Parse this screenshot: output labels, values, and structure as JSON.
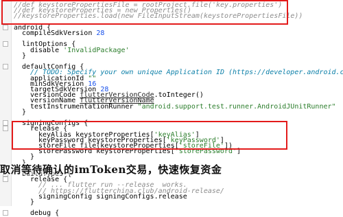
{
  "editor": {
    "lines": [
      {
        "indent": 0,
        "parts": [
          {
            "t": "//def keystorePropertiesFile = rootProject.file('key.properties')",
            "c": "cm"
          }
        ]
      },
      {
        "indent": 0,
        "parts": [
          {
            "t": "//def keystoreProperties = new Properties()",
            "c": "cm"
          }
        ]
      },
      {
        "indent": 0,
        "parts": [
          {
            "t": "//keystoreProperties.load(new FileInputStream(keystorePropertiesFile))",
            "c": "cm"
          }
        ]
      },
      {
        "indent": 0,
        "parts": []
      },
      {
        "indent": 0,
        "parts": [
          {
            "t": "android {",
            "c": "pl"
          }
        ]
      },
      {
        "indent": 1,
        "parts": [
          {
            "t": "compileSdkVersion ",
            "c": "pl"
          },
          {
            "t": "28",
            "c": "num"
          }
        ]
      },
      {
        "indent": 0,
        "parts": []
      },
      {
        "indent": 1,
        "parts": [
          {
            "t": "lintOptions {",
            "c": "pl"
          }
        ]
      },
      {
        "indent": 2,
        "parts": [
          {
            "t": "disable ",
            "c": "pl"
          },
          {
            "t": "'InvalidPackage'",
            "c": "str"
          }
        ]
      },
      {
        "indent": 1,
        "parts": [
          {
            "t": "}",
            "c": "pl"
          }
        ]
      },
      {
        "indent": 0,
        "parts": []
      },
      {
        "indent": 1,
        "parts": [
          {
            "t": "defaultConfig {",
            "c": "pl"
          }
        ]
      },
      {
        "indent": 2,
        "parts": [
          {
            "t": "// TODO: Specify your own unique Application ID (https://developer.android.com",
            "c": "todo"
          }
        ]
      },
      {
        "indent": 2,
        "parts": [
          {
            "t": "applicationId ",
            "c": "pl"
          },
          {
            "t": "\"\"",
            "c": "str"
          }
        ]
      },
      {
        "indent": 2,
        "parts": [
          {
            "t": "minSdkVersion ",
            "c": "pl"
          },
          {
            "t": "16",
            "c": "num"
          }
        ]
      },
      {
        "indent": 2,
        "parts": [
          {
            "t": "targetSdkVersion ",
            "c": "pl"
          },
          {
            "t": "28",
            "c": "num"
          }
        ]
      },
      {
        "indent": 2,
        "parts": [
          {
            "t": "versionCode ",
            "c": "pl"
          },
          {
            "t": "flutterVersionCode",
            "c": "ul"
          },
          {
            "t": ".toInteger()",
            "c": "pl"
          }
        ]
      },
      {
        "indent": 2,
        "parts": [
          {
            "t": "versionName ",
            "c": "pl"
          },
          {
            "t": "flutterVersionName",
            "c": "ul"
          }
        ]
      },
      {
        "indent": 2,
        "parts": [
          {
            "t": "testInstrumentationRunner ",
            "c": "pl"
          },
          {
            "t": "\"android.support.test.runner.AndroidJUnitRunner\"",
            "c": "str"
          }
        ]
      },
      {
        "indent": 1,
        "parts": [
          {
            "t": "}",
            "c": "pl"
          }
        ]
      },
      {
        "indent": 0,
        "parts": []
      },
      {
        "indent": 1,
        "parts": [
          {
            "t": "signingConfigs {",
            "c": "pl"
          }
        ]
      },
      {
        "indent": 2,
        "parts": [
          {
            "t": "release {",
            "c": "pl"
          }
        ]
      },
      {
        "indent": 3,
        "parts": [
          {
            "t": "keyAlias keystoreProperties[",
            "c": "pl"
          },
          {
            "t": "'keyAlias'",
            "c": "str"
          },
          {
            "t": "]",
            "c": "pl"
          }
        ]
      },
      {
        "indent": 3,
        "parts": [
          {
            "t": "keyPassword keystoreProperties[",
            "c": "pl"
          },
          {
            "t": "'keyPassword'",
            "c": "str"
          },
          {
            "t": "]",
            "c": "pl"
          }
        ]
      },
      {
        "indent": 3,
        "parts": [
          {
            "t": "storeFile file(keystoreProperties[",
            "c": "pl"
          },
          {
            "t": "'storeFile'",
            "c": "str"
          },
          {
            "t": "])",
            "c": "pl"
          }
        ]
      },
      {
        "indent": 3,
        "parts": [
          {
            "t": "storePassword keystoreProperties[",
            "c": "pl"
          },
          {
            "t": "'storePassword'",
            "c": "str"
          },
          {
            "t": "]",
            "c": "pl"
          }
        ]
      },
      {
        "indent": 2,
        "parts": [
          {
            "t": "}",
            "c": "pl"
          }
        ]
      },
      {
        "indent": 1,
        "parts": [
          {
            "t": "}",
            "c": "pl"
          }
        ]
      },
      {
        "indent": 0,
        "parts": []
      },
      {
        "indent": 1,
        "parts": [
          {
            "t": "buildTypes {",
            "c": "pl"
          }
        ]
      },
      {
        "indent": 2,
        "parts": [
          {
            "t": "release {",
            "c": "pl"
          }
        ]
      },
      {
        "indent": 3,
        "parts": [
          {
            "t": "// ... flutter run --release  works.",
            "c": "cm"
          }
        ]
      },
      {
        "indent": 3,
        "parts": [
          {
            "t": "// https://flutterchina.club/android-release/",
            "c": "cm"
          }
        ]
      },
      {
        "indent": 3,
        "parts": [
          {
            "t": "signingConfig signingConfigs.release",
            "c": "pl"
          }
        ]
      },
      {
        "indent": 2,
        "parts": [
          {
            "t": "}",
            "c": "pl"
          }
        ]
      },
      {
        "indent": 0,
        "parts": []
      },
      {
        "indent": 2,
        "parts": [
          {
            "t": "debug {",
            "c": "pl"
          }
        ]
      }
    ]
  },
  "overlay": {
    "caption": "取消等待确认的imToken交易，快速恢复资金"
  }
}
